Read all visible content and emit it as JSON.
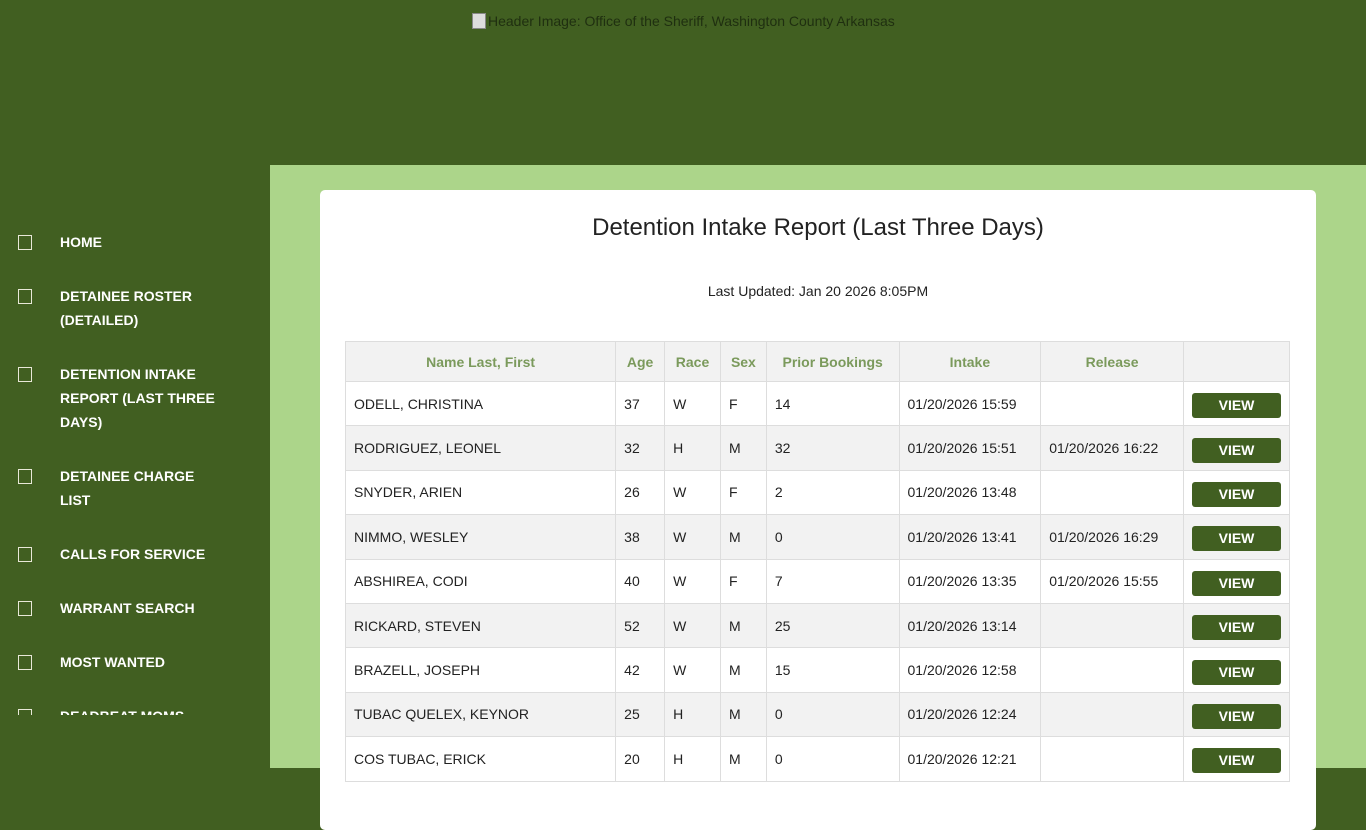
{
  "header": {
    "image_alt": "Header Image: Office of the Sheriff, Washington County Arkansas"
  },
  "nav": [
    {
      "label": "HOME"
    },
    {
      "label": "DETAINEE ROSTER (DETAILED)"
    },
    {
      "label": "DETENTION INTAKE REPORT (LAST THREE DAYS)"
    },
    {
      "label": "DETAINEE CHARGE LIST"
    },
    {
      "label": "CALLS FOR SERVICE"
    },
    {
      "label": "WARRANT SEARCH"
    },
    {
      "label": "MOST WANTED"
    },
    {
      "label": "DEADBEAT MOMS"
    }
  ],
  "page": {
    "title": "Detention Intake Report (Last Three Days)",
    "updated": "Last Updated: Jan 20 2026 8:05PM"
  },
  "table": {
    "headers": [
      "Name Last, First",
      "Age",
      "Race",
      "Sex",
      "Prior Bookings",
      "Intake",
      "Release",
      ""
    ],
    "view_label": "VIEW",
    "rows": [
      [
        "ODELL, CHRISTINA",
        "37",
        "W",
        "F",
        "14",
        "01/20/2026 15:59",
        ""
      ],
      [
        "RODRIGUEZ, LEONEL",
        "32",
        "H",
        "M",
        "32",
        "01/20/2026 15:51",
        "01/20/2026 16:22"
      ],
      [
        "SNYDER, ARIEN",
        "26",
        "W",
        "F",
        "2",
        "01/20/2026 13:48",
        ""
      ],
      [
        "NIMMO, WESLEY",
        "38",
        "W",
        "M",
        "0",
        "01/20/2026 13:41",
        "01/20/2026 16:29"
      ],
      [
        "ABSHIREA, CODI",
        "40",
        "W",
        "F",
        "7",
        "01/20/2026 13:35",
        "01/20/2026 15:55"
      ],
      [
        "RICKARD, STEVEN",
        "52",
        "W",
        "M",
        "25",
        "01/20/2026 13:14",
        ""
      ],
      [
        "BRAZELL, JOSEPH",
        "42",
        "W",
        "M",
        "15",
        "01/20/2026 12:58",
        ""
      ],
      [
        "TUBAC QUELEX, KEYNOR",
        "25",
        "H",
        "M",
        "0",
        "01/20/2026 12:24",
        ""
      ],
      [
        "COS TUBAC, ERICK",
        "20",
        "H",
        "M",
        "0",
        "01/20/2026 12:21",
        ""
      ]
    ]
  }
}
